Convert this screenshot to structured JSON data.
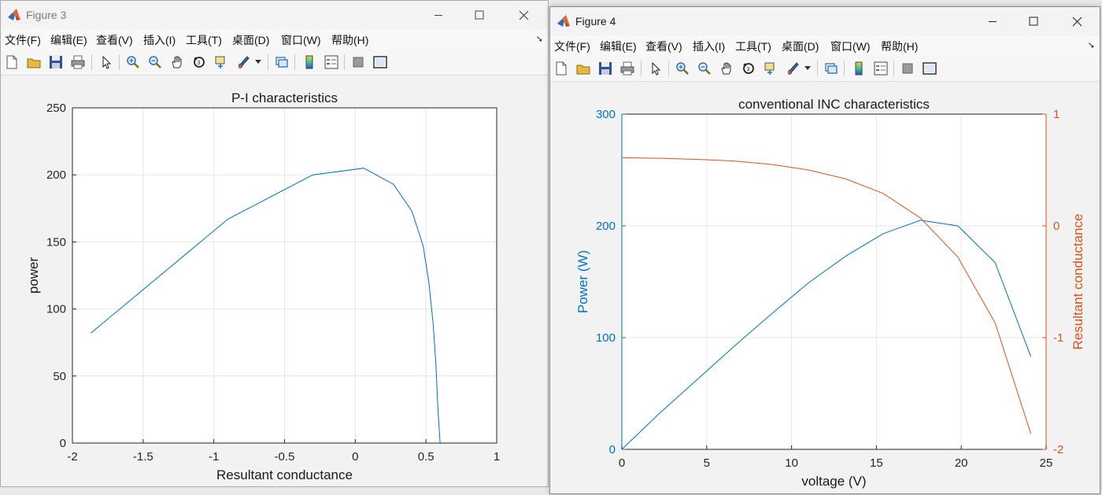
{
  "windows": [
    {
      "id": "win3",
      "title": "Figure 3",
      "menu": [
        "文件(F)",
        "编辑(E)",
        "查看(V)",
        "插入(I)",
        "工具(T)",
        "桌面(D)",
        "窗口(W)",
        "帮助(H)"
      ],
      "toolbar_icons": [
        "new-figure-icon",
        "open-file-icon",
        "save-icon",
        "print-icon",
        "pointer-icon",
        "zoom-in-icon",
        "zoom-out-icon",
        "pan-icon",
        "rotate-3d-icon",
        "data-cursor-icon",
        "brush-icon",
        "brush-dropdown-icon",
        "link-plot-icon",
        "colorbar-icon",
        "legend-icon",
        "hide-plot-tools-icon",
        "show-plot-tools-icon"
      ]
    },
    {
      "id": "win4",
      "title": "Figure 4",
      "menu": [
        "文件(F)",
        "编辑(E)",
        "查看(V)",
        "插入(I)",
        "工具(T)",
        "桌面(D)",
        "窗口(W)",
        "帮助(H)"
      ],
      "toolbar_icons": [
        "new-figure-icon",
        "open-file-icon",
        "save-icon",
        "print-icon",
        "pointer-icon",
        "zoom-in-icon",
        "zoom-out-icon",
        "pan-icon",
        "rotate-3d-icon",
        "data-cursor-icon",
        "brush-icon",
        "brush-dropdown-icon",
        "link-plot-icon",
        "colorbar-icon",
        "legend-icon",
        "hide-plot-tools-icon",
        "show-plot-tools-icon"
      ]
    }
  ],
  "colors": {
    "series_blue": "#0072BD",
    "series_orange": "#D95319",
    "grid": "#e6e6e6"
  },
  "chart_data": [
    {
      "type": "line",
      "title": "P-I characteristics",
      "xlabel": "Resultant conductance",
      "ylabel": "power",
      "xlim": [
        -2,
        1
      ],
      "ylim": [
        0,
        250
      ],
      "xticks": [
        "-2",
        "-1.5",
        "-1",
        "-0.5",
        "0",
        "0.5",
        "1"
      ],
      "yticks": [
        "0",
        "50",
        "100",
        "150",
        "200",
        "250"
      ],
      "grid": true,
      "series": [
        {
          "x": [
            -1.87,
            -0.9,
            -0.3,
            0.06,
            0.27,
            0.4,
            0.48,
            0.52,
            0.55,
            0.57,
            0.585,
            0.6
          ],
          "y": [
            82,
            167,
            200,
            205,
            193,
            173,
            147,
            120,
            90,
            60,
            25,
            0
          ]
        }
      ]
    },
    {
      "type": "line",
      "title": "conventional INC characteristics",
      "xlabel": "voltage (V)",
      "ylabel_left": "Power (W)",
      "ylabel_right": "Resultant conductance",
      "xlim": [
        0,
        25
      ],
      "ylim_left": [
        0,
        300
      ],
      "ylim_right": [
        -2,
        1
      ],
      "xticks": [
        "0",
        "5",
        "10",
        "15",
        "20",
        "25"
      ],
      "yticks_left": [
        "0",
        "100",
        "200",
        "300"
      ],
      "yticks_right": [
        "-2",
        "-1",
        "0",
        "1"
      ],
      "grid": true,
      "series": [
        {
          "axis": "left",
          "x": [
            0,
            2.2,
            4.4,
            6.6,
            8.8,
            11,
            13.2,
            15.4,
            17.6,
            19.8,
            22,
            24.1
          ],
          "y": [
            0,
            32,
            62,
            92,
            121,
            149,
            173,
            193,
            205,
            200,
            167,
            83
          ]
        },
        {
          "axis": "right",
          "x": [
            0,
            2.2,
            4.4,
            6.6,
            8.8,
            11,
            13.2,
            15.4,
            17.6,
            19.8,
            22,
            24.1
          ],
          "y": [
            0.61,
            0.605,
            0.595,
            0.58,
            0.55,
            0.5,
            0.42,
            0.29,
            0.07,
            -0.28,
            -0.87,
            -1.86
          ]
        }
      ]
    }
  ]
}
